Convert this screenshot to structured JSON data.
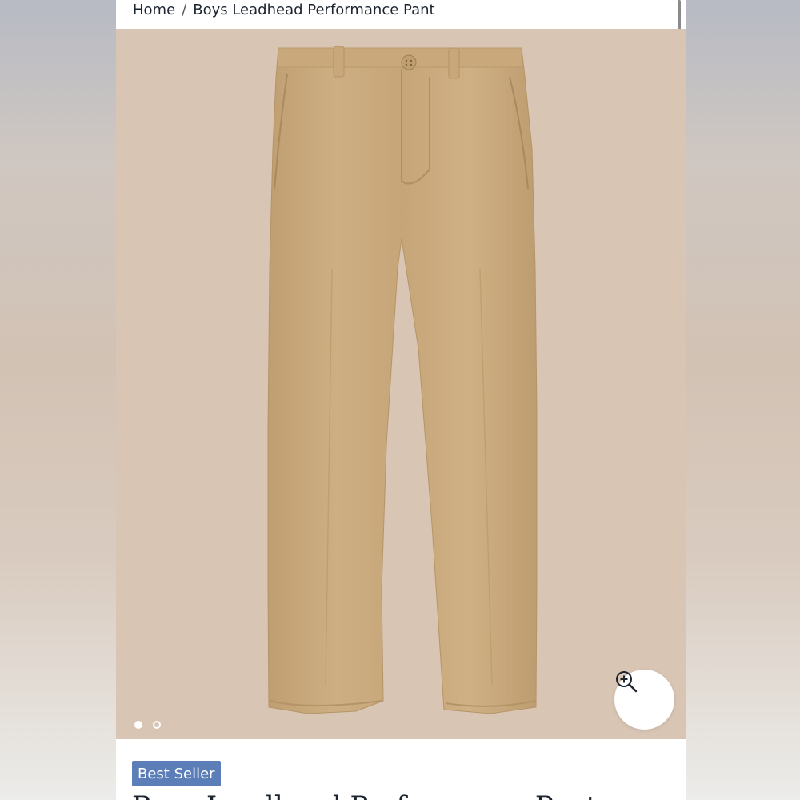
{
  "breadcrumb": {
    "home": "Home",
    "separator": "/",
    "current": "Boys Leadhead Performance Pant"
  },
  "gallery": {
    "image_alt": "Boys Leadhead Performance Pant",
    "slide_count": 2,
    "active_slide": 1,
    "background_color": "#d9c5b4",
    "product_color": "#c9a97c"
  },
  "zoom_button": {
    "icon": "zoom-in-icon"
  },
  "badge": {
    "label": "Best Seller",
    "color": "#5c7eb8"
  },
  "product": {
    "title": "Boys Leadhead Performance Pant"
  }
}
